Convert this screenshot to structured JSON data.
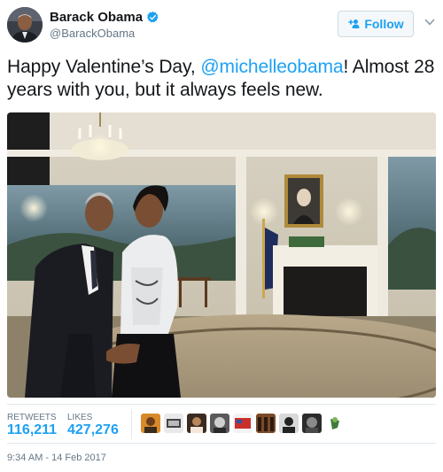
{
  "user": {
    "name": "Barack Obama",
    "handle": "@BarackObama",
    "verified": true
  },
  "follow": {
    "label": "Follow",
    "icon": "add-user-icon"
  },
  "tweet": {
    "text_before": "Happy Valentine’s Day, ",
    "mention": "@michelleobama",
    "text_after": "! Almost 28 years with you, but it always feels new."
  },
  "stats": {
    "retweets_label": "RETWEETS",
    "retweets_value": "116,211",
    "likes_label": "LIKES",
    "likes_value": "427,276"
  },
  "timestamp": "9:34 AM - 14 Feb 2017",
  "colors": {
    "accent": "#1da1f2",
    "secondary_text": "#657786",
    "primary_text": "#14171a"
  }
}
